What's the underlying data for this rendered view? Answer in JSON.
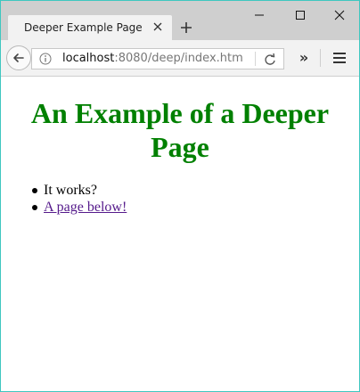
{
  "browser": {
    "tab": {
      "title": "Deeper Example Page"
    },
    "address_bar": {
      "host": "localhost",
      "rest": ":8080/deep/index.htm"
    },
    "overflow_glyph": "»"
  },
  "page": {
    "heading": "An Example of a Deeper Page",
    "list_items": [
      {
        "text": "It works?"
      },
      {
        "text": "A page below!"
      }
    ],
    "colors": {
      "heading": "#008000",
      "visited_link": "#551a8b"
    }
  }
}
